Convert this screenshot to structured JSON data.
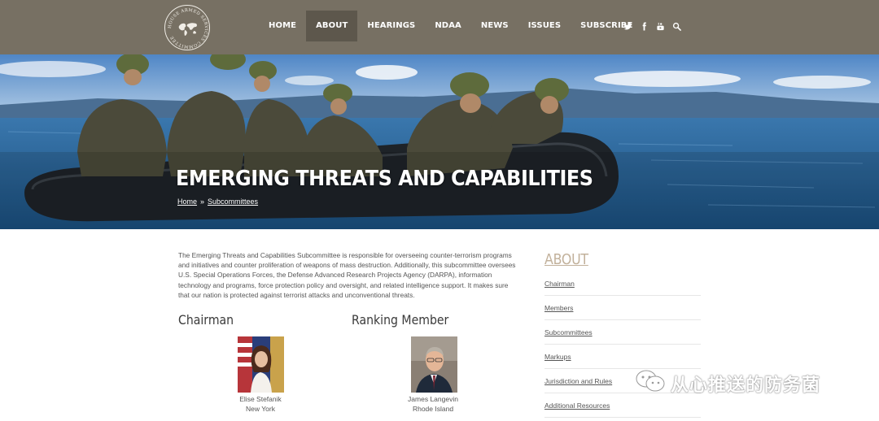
{
  "header": {
    "seal_text": "HOUSE ARMED SERVICES COMMITTEE",
    "nav": [
      {
        "label": "HOME",
        "active": false
      },
      {
        "label": "ABOUT",
        "active": true
      },
      {
        "label": "HEARINGS",
        "active": false
      },
      {
        "label": "NDAA",
        "active": false
      },
      {
        "label": "NEWS",
        "active": false
      },
      {
        "label": "ISSUES",
        "active": false
      },
      {
        "label": "SUBSCRIBE",
        "active": false
      }
    ],
    "social_icons": [
      "twitter-icon",
      "facebook-icon",
      "youtube-icon",
      "search-icon"
    ]
  },
  "hero": {
    "title": "EMERGING THREATS AND CAPABILITIES",
    "breadcrumb": {
      "home": "Home",
      "separator": "»",
      "current": "Subcommittees"
    }
  },
  "main": {
    "intro": "The Emerging Threats and Capabilities Subcommittee is responsible for overseeing counter-terrorism programs and initiatives and counter proliferation of weapons of mass destruction. Additionally, this subcommittee oversees U.S. Special Operations Forces, the Defense Advanced Research Projects Agency (DARPA), information technology and programs, force protection policy and oversight, and related intelligence support. It makes sure that our nation is protected against terrorist attacks and unconventional threats.",
    "chairman": {
      "heading": "Chairman",
      "name": "Elise Stefanik",
      "state": "New York"
    },
    "ranking": {
      "heading": "Ranking Member",
      "name": "James Langevin",
      "state": "Rhode Island"
    }
  },
  "sidebar": {
    "title": "ABOUT",
    "items": [
      {
        "label": "Chairman"
      },
      {
        "label": "Members"
      },
      {
        "label": "Subcommittees"
      },
      {
        "label": "Markups"
      },
      {
        "label": "Jurisdiction and Rules"
      },
      {
        "label": "Additional Resources"
      }
    ]
  },
  "watermark": {
    "text": "从心推送的防务菌"
  },
  "colors": {
    "header_bg": "#777063",
    "nav_active_bg": "#5d574c",
    "sidebar_title": "#c2b19b"
  }
}
